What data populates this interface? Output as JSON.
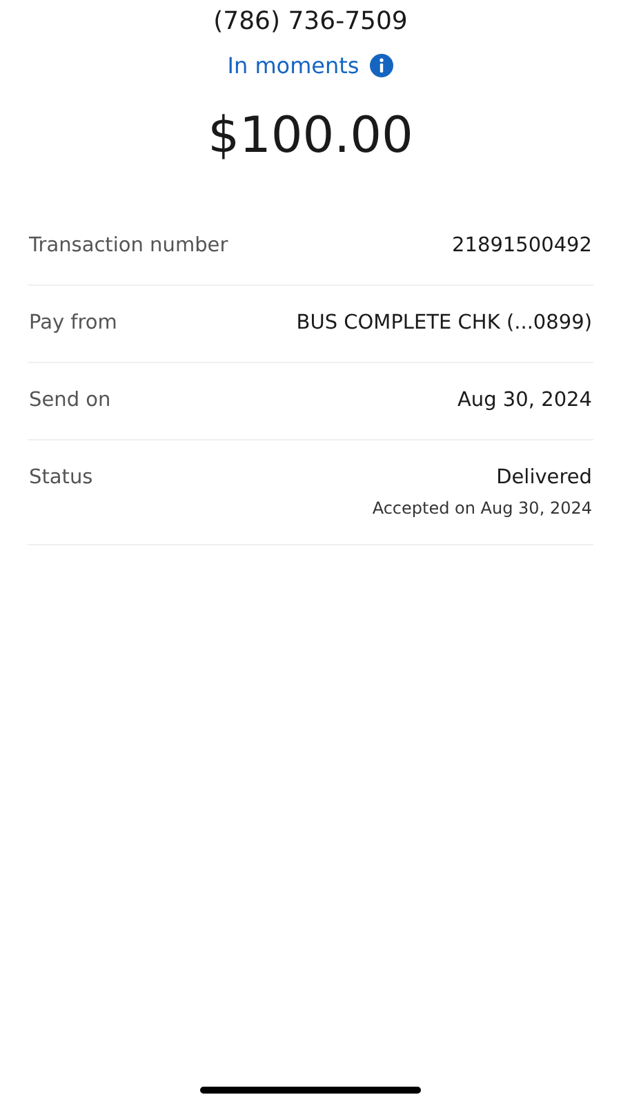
{
  "recipient": {
    "phone": "(786) 736-7509"
  },
  "delivery": {
    "label": "In moments"
  },
  "amount": "$100.00",
  "details": [
    {
      "label": "Transaction number",
      "value": "21891500492"
    },
    {
      "label": "Pay from",
      "value": "BUS COMPLETE CHK (...0899)"
    },
    {
      "label": "Send on",
      "value": "Aug 30, 2024"
    },
    {
      "label": "Status",
      "value": "Delivered",
      "note": "Accepted on Aug 30, 2024"
    }
  ]
}
